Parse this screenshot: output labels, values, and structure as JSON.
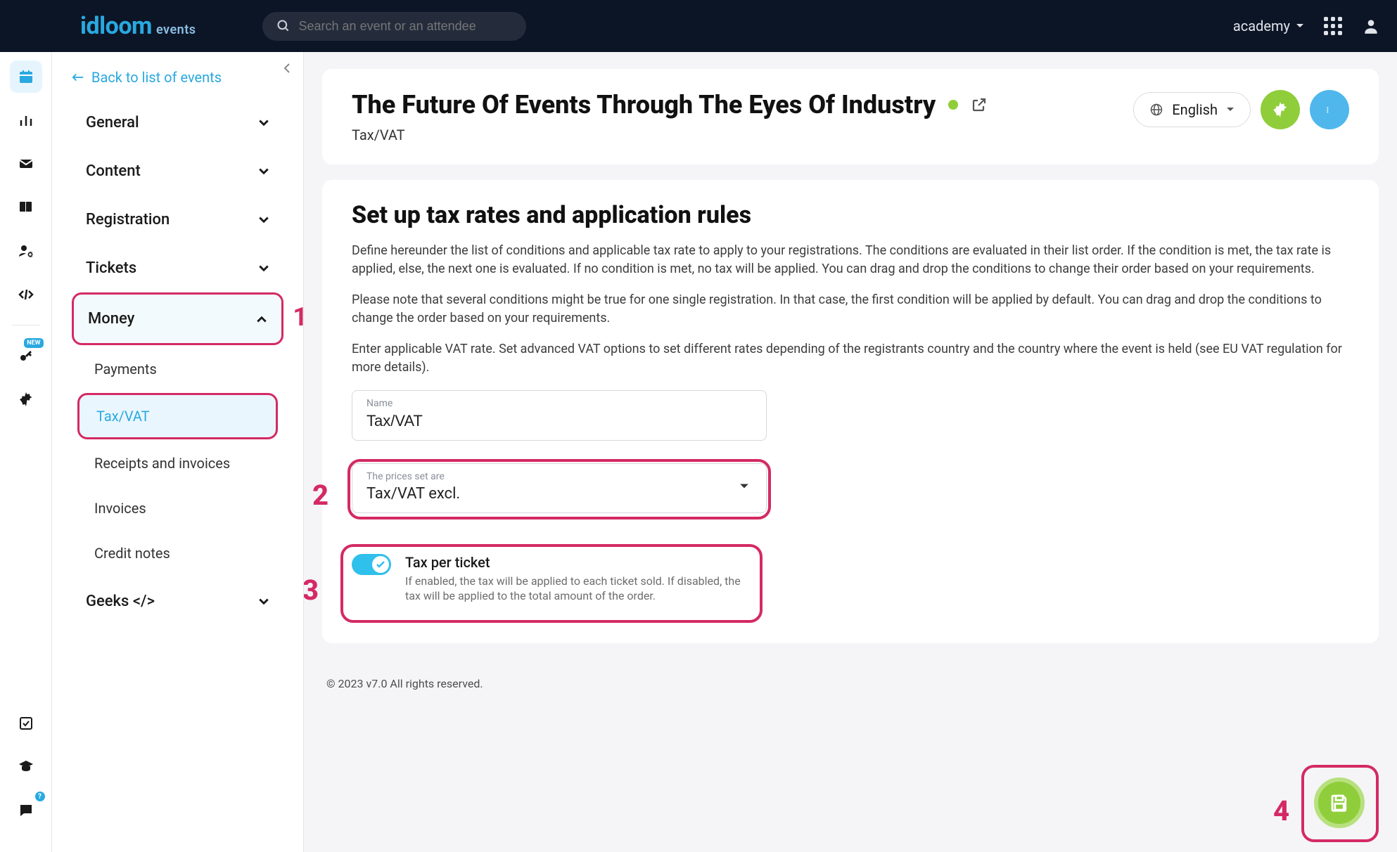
{
  "topbar": {
    "logo_main": "idloom",
    "logo_sub": "events",
    "search_placeholder": "Search an event or an attendee",
    "account_label": "academy"
  },
  "rail": {
    "badge_new": "NEW",
    "badge_q": "?"
  },
  "sidenav": {
    "back_label": "Back to list of events",
    "items": {
      "general": "General",
      "content": "Content",
      "registration": "Registration",
      "tickets": "Tickets",
      "money": "Money",
      "geeks": "Geeks </>"
    },
    "money_sub": {
      "payments": "Payments",
      "taxvat": "Tax/VAT",
      "receipts": "Receipts and invoices",
      "invoices": "Invoices",
      "credit": "Credit notes"
    }
  },
  "header": {
    "title": "The Future Of Events Through The Eyes Of Industry",
    "crumb": "Tax/VAT",
    "lang": "English"
  },
  "content": {
    "heading": "Set up tax rates and application rules",
    "p1": "Define hereunder the list of conditions and applicable tax rate to apply to your registrations. The conditions are evaluated in their list order. If the condition is met, the tax rate is applied, else, the next one is evaluated. If no condition is met, no tax will be applied. You can drag and drop the conditions to change their order based on your requirements.",
    "p2": "Please note that several conditions might be true for one single registration. In that case, the first condition will be applied by default. You can drag and drop the conditions to change the order based on your requirements.",
    "p3": "Enter applicable VAT rate. Set advanced VAT options to set different rates depending of the registrants country and the country where the event is held (see EU VAT regulation for more details).",
    "name_label": "Name",
    "name_value": "Tax/VAT",
    "prices_label": "The prices set are",
    "prices_value": "Tax/VAT excl.",
    "toggle_title": "Tax per ticket",
    "toggle_desc": "If enabled, the tax will be applied to each ticket sold. If disabled, the tax will be applied to the total amount of the order."
  },
  "footer": {
    "copyright": "© 2023 v7.0 All rights reserved."
  },
  "annotations": {
    "n1": "1",
    "n2": "2",
    "n3": "3",
    "n4": "4"
  }
}
